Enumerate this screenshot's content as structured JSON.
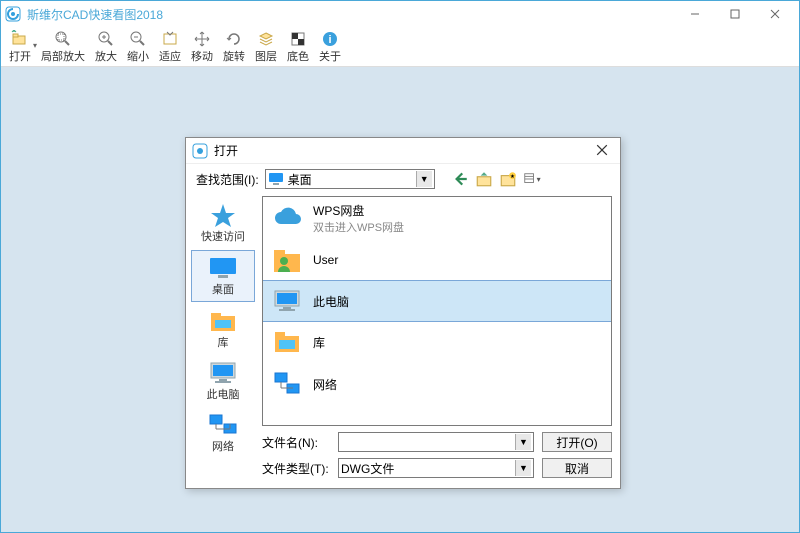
{
  "window": {
    "title": "斯维尔CAD快速看图2018"
  },
  "toolbar": {
    "items": [
      {
        "label": "打开",
        "icon": "open"
      },
      {
        "label": "局部放大",
        "icon": "zoomregion"
      },
      {
        "label": "放大",
        "icon": "zoomin"
      },
      {
        "label": "缩小",
        "icon": "zoomout"
      },
      {
        "label": "适应",
        "icon": "fit"
      },
      {
        "label": "移动",
        "icon": "pan"
      },
      {
        "label": "旋转",
        "icon": "rotate"
      },
      {
        "label": "图层",
        "icon": "layers"
      },
      {
        "label": "底色",
        "icon": "bgcolor"
      },
      {
        "label": "关于",
        "icon": "about"
      }
    ]
  },
  "dialog": {
    "title": "打开",
    "lookin_label": "查找范围(I):",
    "lookin_value": "桌面",
    "places": [
      {
        "label": "快速访问",
        "icon": "quick"
      },
      {
        "label": "桌面",
        "icon": "desktop"
      },
      {
        "label": "库",
        "icon": "libraries"
      },
      {
        "label": "此电脑",
        "icon": "thispc"
      },
      {
        "label": "网络",
        "icon": "network"
      }
    ],
    "files": [
      {
        "name": "WPS网盘",
        "sub": "双击进入WPS网盘",
        "icon": "cloud",
        "selected": false
      },
      {
        "name": "User",
        "sub": "",
        "icon": "user",
        "selected": false
      },
      {
        "name": "此电脑",
        "sub": "",
        "icon": "pc",
        "selected": true
      },
      {
        "name": "库",
        "sub": "",
        "icon": "lib",
        "selected": false
      },
      {
        "name": "网络",
        "sub": "",
        "icon": "net",
        "selected": false
      }
    ],
    "filename_label": "文件名(N):",
    "filename_value": "",
    "filetype_label": "文件类型(T):",
    "filetype_value": "DWG文件",
    "open_btn": "打开(O)",
    "cancel_btn": "取消"
  }
}
